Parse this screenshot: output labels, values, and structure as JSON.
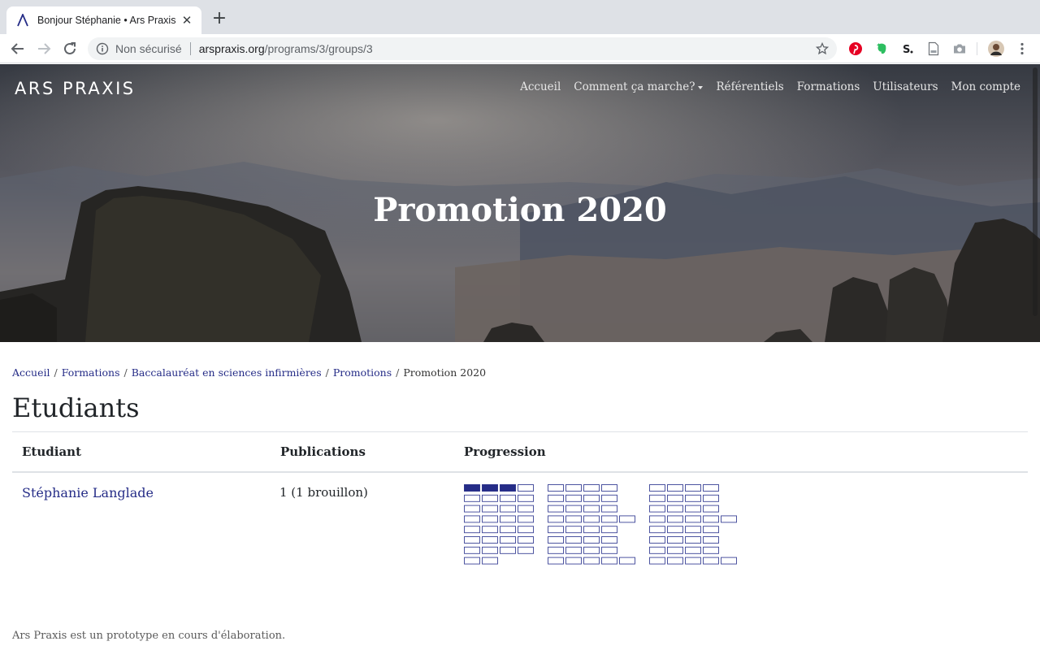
{
  "browser": {
    "tab_title": "Bonjour Stéphanie • Ars Praxis",
    "security_label": "Non sécurisé",
    "url_host": "arspraxis.org",
    "url_path": "/programs/3/groups/3"
  },
  "site": {
    "brand": "ARS PRAXIS",
    "nav": {
      "home": "Accueil",
      "how": "Comment ça marche?",
      "referentials": "Référentiels",
      "formations": "Formations",
      "users": "Utilisateurs",
      "account": "Mon compte"
    },
    "hero_title": "Promotion 2020"
  },
  "breadcrumb": {
    "home": "Accueil",
    "formations": "Formations",
    "program": "Baccalauréat en sciences infirmières",
    "promotions": "Promotions",
    "current": "Promotion 2020",
    "separator": "/"
  },
  "page": {
    "section_title": "Etudiants",
    "columns": {
      "student": "Etudiant",
      "publications": "Publications",
      "progression": "Progression"
    },
    "rows": [
      {
        "student": "Stéphanie Langlade",
        "publications": "1 (1 brouillon)"
      }
    ]
  },
  "progression": {
    "filled_color": "#252c87",
    "empty_border_color": "#3a4296",
    "groups": [
      {
        "rows": [
          4,
          4,
          4,
          4,
          4,
          4,
          4,
          2
        ],
        "filled": [
          3,
          0,
          0,
          0,
          0,
          0,
          0,
          0
        ]
      },
      {
        "rows": [
          4,
          4,
          4,
          5,
          4,
          4,
          4,
          5
        ],
        "filled": [
          0,
          0,
          0,
          0,
          0,
          0,
          0,
          0
        ]
      },
      {
        "rows": [
          4,
          4,
          4,
          5,
          4,
          4,
          4,
          5
        ],
        "filled": [
          0,
          0,
          0,
          0,
          0,
          0,
          0,
          0
        ]
      }
    ]
  },
  "footer": {
    "text": "Ars Praxis est un prototype en cours d'élaboration."
  }
}
